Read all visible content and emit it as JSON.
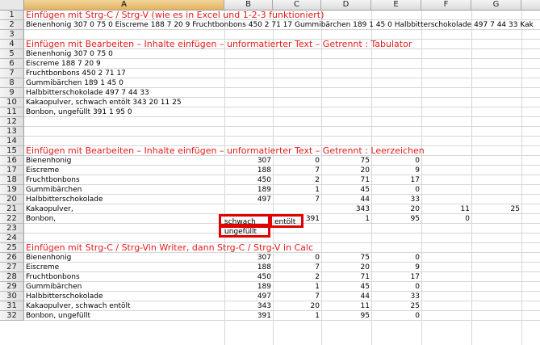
{
  "columns": [
    "A",
    "B",
    "C",
    "D",
    "E",
    "F",
    "G"
  ],
  "rows": [
    {
      "n": "1",
      "title": "Einfügen mit Strg-C / Strg-V (wie es in Excel und 1-2-3 funktioniert)"
    },
    {
      "n": "2",
      "a": "Bienenhonig 307 0 75 0 Eiscreme 188 7 20 9 Fruchtbonbons 450 2 71 17 Gummibärchen 189 1 45 0 Halbbitterschokolade 497 7 44 33 Kak"
    },
    {
      "n": "3"
    },
    {
      "n": "4",
      "title": "Einfügen mit Bearbeiten – Inhalte einfügen – unformatierter Text – Getrennt : Tabulator"
    },
    {
      "n": "5",
      "a": "Bienenhonig 307 0 75 0"
    },
    {
      "n": "6",
      "a": "Eiscreme 188 7 20 9"
    },
    {
      "n": "7",
      "a": "Fruchtbonbons 450 2 71 17"
    },
    {
      "n": "8",
      "a": "Gummibärchen 189 1 45 0"
    },
    {
      "n": "9",
      "a": "Halbbitterschokolade 497 7 44 33"
    },
    {
      "n": "10",
      "a": "Kakaopulver, schwach entölt 343 20 11 25"
    },
    {
      "n": "11",
      "a": "Bonbon, ungefüllt 391 1 95 0"
    },
    {
      "n": "12"
    },
    {
      "n": "13"
    },
    {
      "n": "14"
    },
    {
      "n": "15",
      "title": "Einfügen mit Bearbeiten – Inhalte einfügen – unformatierter Text – Getrennt : Leerzeichen"
    },
    {
      "n": "16",
      "a": "Bienenhonig",
      "b": "307",
      "c": "0",
      "d": "75",
      "e": "0"
    },
    {
      "n": "17",
      "a": "Eiscreme",
      "b": "188",
      "c": "7",
      "d": "20",
      "e": "9"
    },
    {
      "n": "18",
      "a": "Fruchtbonbons",
      "b": "450",
      "c": "2",
      "d": "71",
      "e": "17"
    },
    {
      "n": "19",
      "a": "Gummibärchen",
      "b": "189",
      "c": "1",
      "d": "45",
      "e": "0"
    },
    {
      "n": "20",
      "a": "Halbbitterschokolade",
      "b": "497",
      "c": "7",
      "d": "44",
      "e": "33"
    },
    {
      "n": "21",
      "a": "Kakaopulver,",
      "d": "343",
      "e": "20",
      "f": "11",
      "g": "25"
    },
    {
      "n": "22",
      "a": "Bonbon,",
      "c": "391",
      "d": "1",
      "e": "95",
      "f": "0"
    },
    {
      "n": "23"
    },
    {
      "n": "24"
    },
    {
      "n": "25",
      "title": "Einfügen mit Strg-C / Strg-Vin Writer, dann Strg-C / Strg-V in Calc"
    },
    {
      "n": "26",
      "a": "Bienenhonig",
      "b": "307",
      "c": "0",
      "d": "75",
      "e": "0"
    },
    {
      "n": "27",
      "a": "Eiscreme",
      "b": "188",
      "c": "7",
      "d": "20",
      "e": "9"
    },
    {
      "n": "28",
      "a": "Fruchtbonbons",
      "b": "450",
      "c": "2",
      "d": "71",
      "e": "17"
    },
    {
      "n": "29",
      "a": "Gummibärchen",
      "b": "189",
      "c": "1",
      "d": "45",
      "e": "0"
    },
    {
      "n": "30",
      "a": "Halbbitterschokolade",
      "b": "497",
      "c": "7",
      "d": "44",
      "e": "33"
    },
    {
      "n": "31",
      "a": "Kakaopulver, schwach entölt",
      "b": "343",
      "c": "20",
      "d": "11",
      "e": "25"
    },
    {
      "n": "32",
      "a": "Bonbon, ungefüllt",
      "b": "391",
      "c": "1",
      "d": "95",
      "e": "0"
    }
  ],
  "highlights": {
    "b21": "schwach",
    "c21": "entölt",
    "b22": "ungefüllt"
  },
  "colors": {
    "title_red": "#e31a1a",
    "highlight_red": "#e00000",
    "selected_header": "#e8bd6c"
  },
  "selected_column": "A"
}
